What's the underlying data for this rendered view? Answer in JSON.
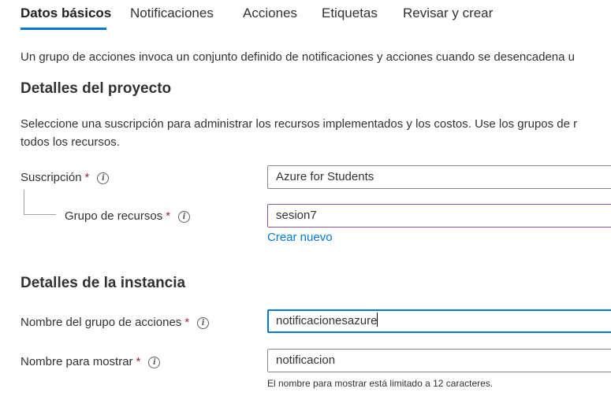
{
  "tabs": [
    {
      "label": "Datos básicos",
      "active": true
    },
    {
      "label": "Notificaciones",
      "active": false
    },
    {
      "label": "Acciones",
      "active": false
    },
    {
      "label": "Etiquetas",
      "active": false
    },
    {
      "label": "Revisar y crear",
      "active": false
    }
  ],
  "intro": "Un grupo de acciones invoca un conjunto definido de notificaciones y acciones cuando se desencadena u",
  "project": {
    "heading": "Detalles del proyecto",
    "description_line1": "Seleccione una suscripción para administrar los recursos implementados y los costos. Use los grupos de r",
    "description_line2": "todos los recursos.",
    "subscription": {
      "label": "Suscripción",
      "required": "*",
      "value": "Azure for Students"
    },
    "resource_group": {
      "label": "Grupo de recursos",
      "required": "*",
      "value": "sesion7",
      "create_new": "Crear nuevo"
    }
  },
  "instance": {
    "heading": "Detalles de la instancia",
    "action_group_name": {
      "label": "Nombre del grupo de acciones",
      "required": "*",
      "value": "notificacionesazure"
    },
    "display_name": {
      "label": "Nombre para mostrar",
      "required": "*",
      "value": "notificacion",
      "hint": "El nombre para mostrar está limitado a 12 caracteres."
    }
  },
  "colors": {
    "accent": "#0078d4",
    "required": "#a4262c",
    "border": "#8a8886"
  }
}
